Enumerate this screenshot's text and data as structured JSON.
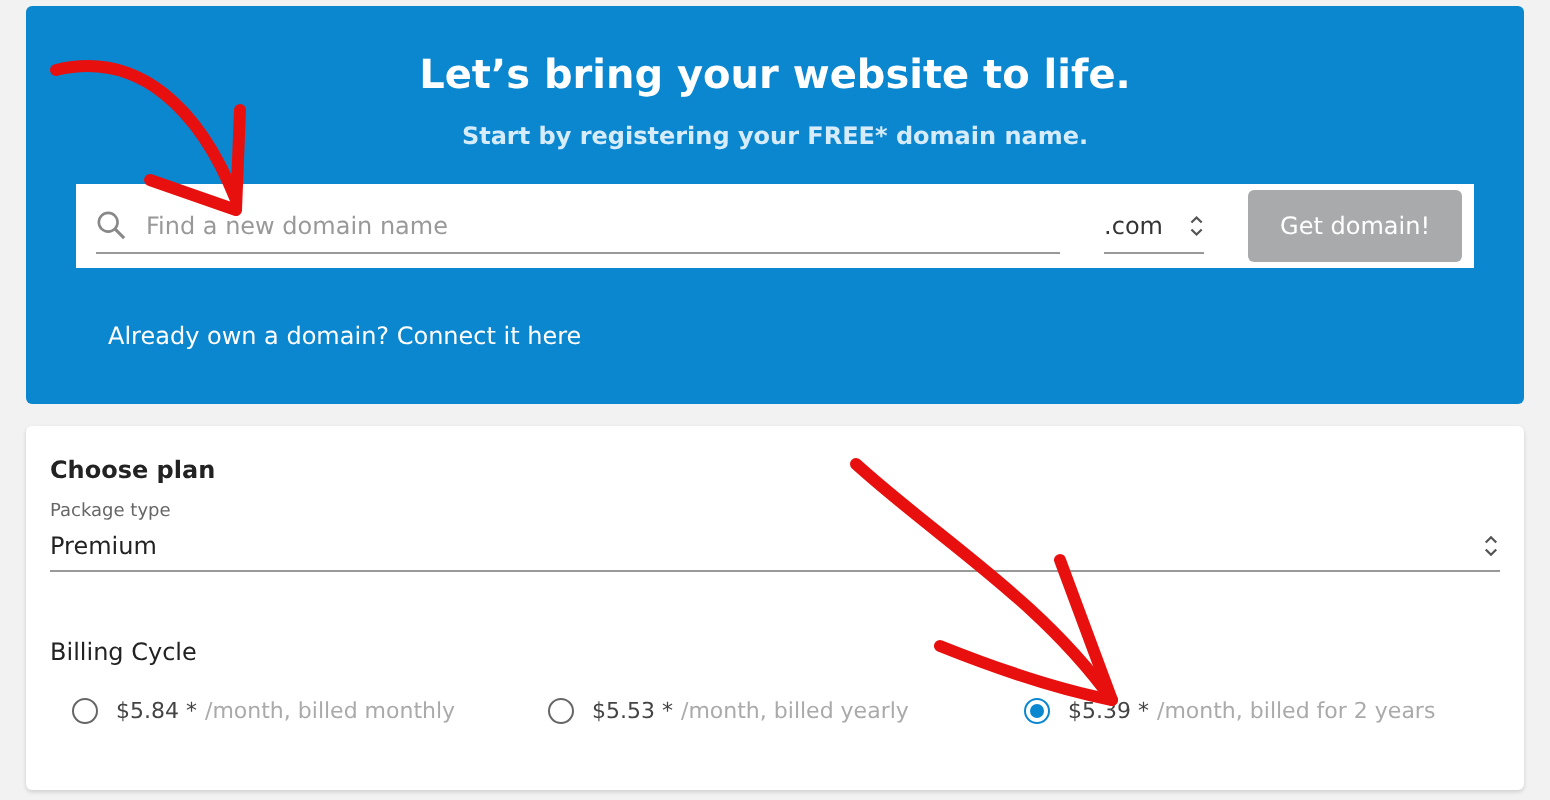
{
  "hero": {
    "title": "Let’s bring your website to life.",
    "subtitle": "Start by registering your FREE* domain name.",
    "search": {
      "placeholder": "Find a new domain name"
    },
    "tld": ".com",
    "button": {
      "label": "Get domain!",
      "disabled": true
    },
    "link": "Already own a domain? Connect it here"
  },
  "plan": {
    "title": "Choose plan",
    "package_label": "Package type",
    "package_value": "Premium",
    "billing_title": "Billing Cycle",
    "options": [
      {
        "price": "$5.84 *",
        "note": "/month, billed monthly",
        "selected": false
      },
      {
        "price": "$5.53 *",
        "note": "/month, billed yearly",
        "selected": false
      },
      {
        "price": "$5.39 *",
        "note": "/month, billed for 2 years",
        "selected": true
      }
    ]
  }
}
